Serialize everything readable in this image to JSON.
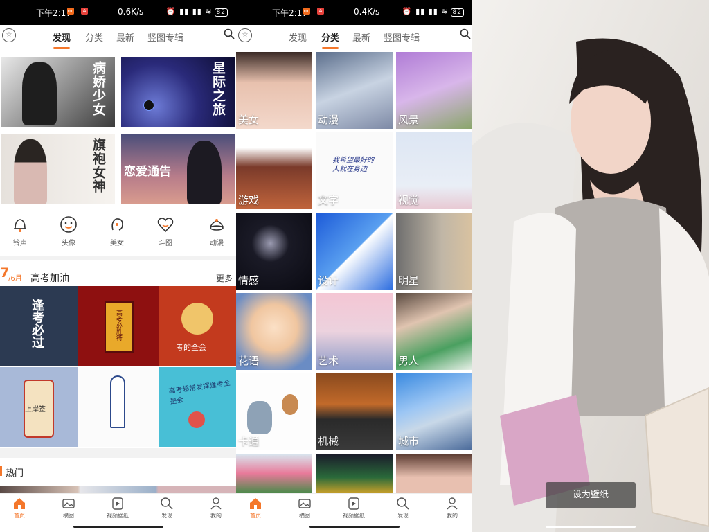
{
  "colors": {
    "accent": "#f4772b"
  },
  "screen1": {
    "status": {
      "time": "下午2:17",
      "speed": "0.6K/s",
      "battery": "82"
    },
    "tabs": [
      "发现",
      "分类",
      "最新",
      "竖图专辑"
    ],
    "active_tab": 0,
    "banners": [
      "病娇少女",
      "星际之旅",
      "旗袍女神",
      "恋爱通告"
    ],
    "quick_items": [
      {
        "label": "铃声",
        "icon": "bell-icon"
      },
      {
        "label": "头像",
        "icon": "face-icon"
      },
      {
        "label": "美女",
        "icon": "girl-head-icon"
      },
      {
        "label": "斗图",
        "icon": "heart-face-icon"
      },
      {
        "label": "动漫",
        "icon": "anime-icon"
      }
    ],
    "section": {
      "date_day": "7",
      "date_month": "/6月",
      "title": "高考加油",
      "more": "更多"
    },
    "grid_texts": [
      "逢考必过",
      "高考必胜符",
      "考的全会",
      "上岸签",
      "",
      "高考超常发挥逢考全是会"
    ],
    "hot_title": "热门"
  },
  "screen2": {
    "status": {
      "time": "下午2:17",
      "speed": "0.4K/s",
      "battery": "82"
    },
    "tabs": [
      "发现",
      "分类",
      "最新",
      "竖图专辑"
    ],
    "active_tab": 1,
    "categories": [
      "美女",
      "动漫",
      "风景",
      "游戏",
      "文字",
      "视觉",
      "情感",
      "设计",
      "明星",
      "花语",
      "艺术",
      "男人",
      "卡通",
      "机械",
      "城市"
    ],
    "text_card": "我希望最好的人就在身边"
  },
  "screen3": {
    "button": "设为壁纸"
  },
  "bottom_nav": [
    {
      "label": "首页",
      "icon": "home-icon"
    },
    {
      "label": "横图",
      "icon": "image-icon"
    },
    {
      "label": "视频壁纸",
      "icon": "video-icon"
    },
    {
      "label": "发现",
      "icon": "search-icon"
    },
    {
      "label": "我的",
      "icon": "profile-icon"
    }
  ]
}
